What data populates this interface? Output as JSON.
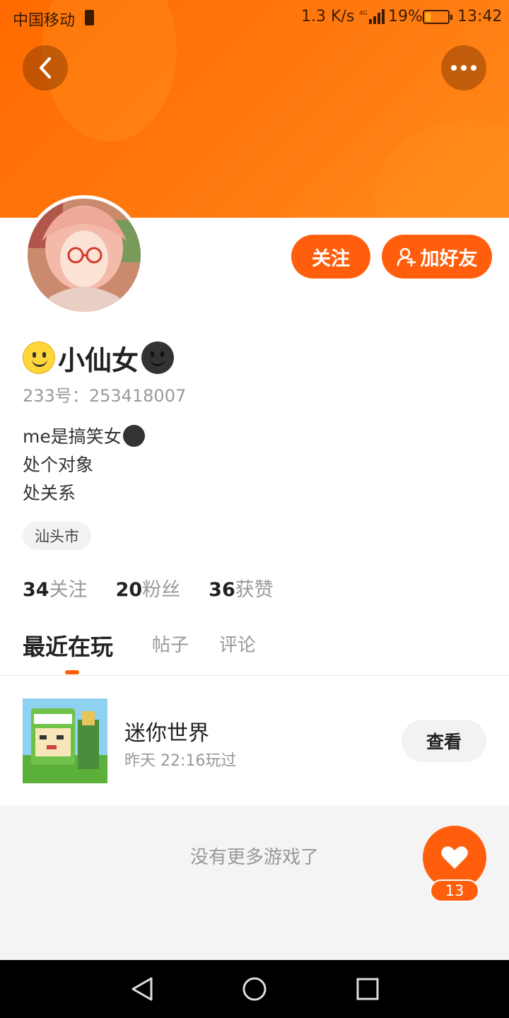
{
  "status_bar": {
    "carrier": "中国移动",
    "network_speed": "1.3 K/s",
    "network_type": "4G",
    "battery_percent": "19%",
    "time": "13:42"
  },
  "header": {
    "back_icon": "chevron-left-icon",
    "more_icon": "more-horizontal-icon"
  },
  "profile": {
    "avatar_icon": "anime-avatar",
    "username": "小仙女",
    "uid_label": "233号：",
    "uid": "253418007",
    "bio_lines": [
      "me是搞笑女",
      "处个对象",
      "处关系"
    ],
    "location": "汕头市",
    "follow_label": "关注",
    "add_friend_label": "加好友"
  },
  "stats": [
    {
      "num": "34",
      "label": "关注"
    },
    {
      "num": "20",
      "label": "粉丝"
    },
    {
      "num": "36",
      "label": "获赞"
    }
  ],
  "tabs": [
    {
      "label": "最近在玩",
      "active": true
    },
    {
      "label": "帖子",
      "active": false
    },
    {
      "label": "评论",
      "active": false
    }
  ],
  "games": [
    {
      "name": "迷你世界",
      "played": "昨天 22:16玩过",
      "action": "查看"
    }
  ],
  "footer": {
    "no_more_text": "没有更多游戏了",
    "like_count": "13"
  },
  "colors": {
    "accent": "#ff5f0d",
    "header_gradient_start": "#ff6a00",
    "header_gradient_end": "#ff8a1a"
  }
}
